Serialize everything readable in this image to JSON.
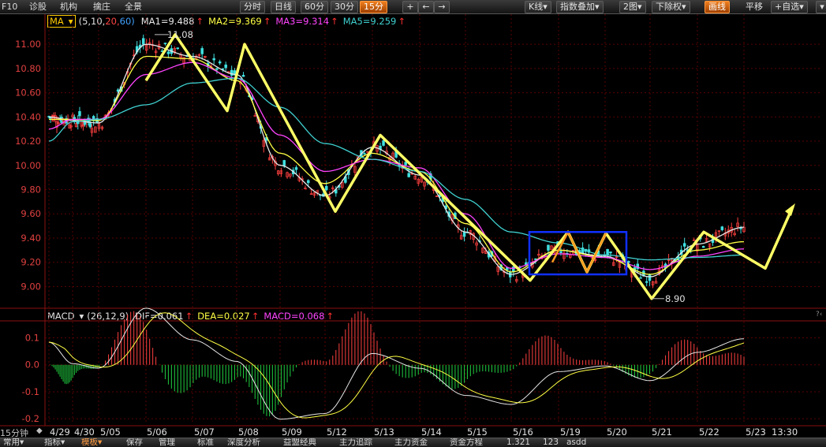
{
  "toolbar": {
    "f10_label": "F10",
    "menu": [
      "诊股",
      "机构",
      "擒庄",
      "全景"
    ],
    "periods": [
      "分时",
      "日线",
      "60分",
      "30分",
      "15分"
    ],
    "active_period": "15分",
    "nav_buttons": [
      "+",
      "←",
      "→"
    ],
    "right_buttons": [
      "K线",
      "指数叠加",
      "2图",
      "下除权",
      "画线",
      "平移",
      "+自选"
    ],
    "right_buttons_dropdown": [
      true,
      true,
      true,
      true,
      false,
      false,
      true
    ],
    "active_right": "画线"
  },
  "ma_legend": {
    "selector": "MA",
    "params_prefix": "(5,10,",
    "params_mid": "20,",
    "params_end": "60)",
    "ma1": "MA1=9.488",
    "ma2": "MA2=9.369",
    "ma3": "MA3=9.314",
    "ma5": "MA5=9.259",
    "up_arrow": "↑",
    "colors": {
      "ma1": "#e8e8e8",
      "ma2": "#ffff44",
      "ma3": "#ff44ff",
      "ma5": "#40d0d0",
      "params_mid": "#ff4444",
      "params_end": "#40a0ff"
    }
  },
  "macd_legend": {
    "selector": "MACD",
    "params": "(26,12,9)",
    "dif": "DIF=0.061",
    "dea": "DEA=0.027",
    "macd": "MACD=0.068",
    "up_arrow": "↑"
  },
  "price_axis": {
    "labels": [
      "11.00",
      "10.80",
      "10.60",
      "10.40",
      "10.20",
      "10.00",
      "9.80",
      "9.60",
      "9.40",
      "9.20",
      "9.00"
    ],
    "values": [
      11.0,
      10.8,
      10.6,
      10.4,
      10.2,
      10.0,
      9.8,
      9.6,
      9.4,
      9.2,
      9.0
    ],
    "range": [
      8.84,
      11.17
    ]
  },
  "macd_axis": {
    "labels": [
      "0.1",
      "0.0",
      "-0.1",
      "-0.2"
    ],
    "values": [
      0.1,
      0.0,
      -0.1,
      -0.2
    ],
    "range": [
      -0.22,
      0.16
    ]
  },
  "dates": [
    "4/29",
    "4/30",
    "5/05",
    "5/06",
    "5/07",
    "5/08",
    "5/09",
    "5/12",
    "5/13",
    "5/14",
    "5/15",
    "5/16",
    "5/19",
    "5/20",
    "5/21",
    "5/22",
    "5/23"
  ],
  "end_time": "13:30",
  "period_label": "15分钟",
  "annotations": {
    "high": "11.08",
    "low": "8.90"
  },
  "bottom_tabs": [
    "常用",
    "指标",
    "模板",
    "保存",
    "管理",
    "标准",
    "深度分析",
    "益盟经典",
    "主力追踪",
    "主力资金",
    "资金方程",
    "1.321",
    "123",
    "asdd"
  ],
  "bottom_tabs_dropdown": [
    true,
    true,
    true,
    false,
    false,
    false,
    false,
    false,
    false,
    false,
    false,
    false,
    false,
    false
  ],
  "active_bottom_tab": "模板",
  "chart_data": {
    "type": "line",
    "title": "",
    "xlabel": "",
    "ylabel": "",
    "ylim": [
      8.84,
      11.17
    ],
    "x": [
      "4/29",
      "4/30",
      "5/05",
      "5/06",
      "5/07",
      "5/08",
      "5/09",
      "5/12",
      "5/13",
      "5/14",
      "5/15",
      "5/16",
      "5/19",
      "5/20",
      "5/21",
      "5/22",
      "5/23"
    ],
    "series": [
      {
        "name": "MA1",
        "values": [
          10.4,
          10.37,
          10.35,
          11.0,
          10.9,
          10.75,
          10.0,
          9.75,
          10.15,
          9.92,
          9.45,
          9.1,
          9.3,
          9.25,
          9.08,
          9.35,
          9.49
        ]
      },
      {
        "name": "MA2",
        "values": [
          10.38,
          10.38,
          10.37,
          10.9,
          10.88,
          10.7,
          10.1,
          9.85,
          10.1,
          9.95,
          9.52,
          9.12,
          9.3,
          9.24,
          9.1,
          9.3,
          9.37
        ]
      },
      {
        "name": "MA3",
        "values": [
          10.3,
          10.38,
          10.38,
          10.75,
          10.85,
          10.72,
          10.25,
          9.95,
          10.05,
          9.98,
          9.6,
          9.15,
          9.27,
          9.24,
          9.14,
          9.25,
          9.31
        ]
      },
      {
        "name": "MA5",
        "values": [
          10.2,
          10.36,
          10.38,
          10.5,
          10.68,
          10.72,
          10.48,
          10.18,
          10.05,
          9.95,
          9.72,
          9.45,
          9.36,
          9.26,
          9.22,
          9.24,
          9.26
        ]
      }
    ],
    "drawn_zigzag": [
      10.7,
      11.08,
      10.45,
      11.0,
      9.62,
      10.25,
      9.05,
      9.45,
      9.12,
      9.44,
      8.9,
      9.45,
      9.15,
      9.66
    ],
    "macd": {
      "dif": 0.061,
      "dea": 0.027,
      "macd": 0.068
    }
  }
}
